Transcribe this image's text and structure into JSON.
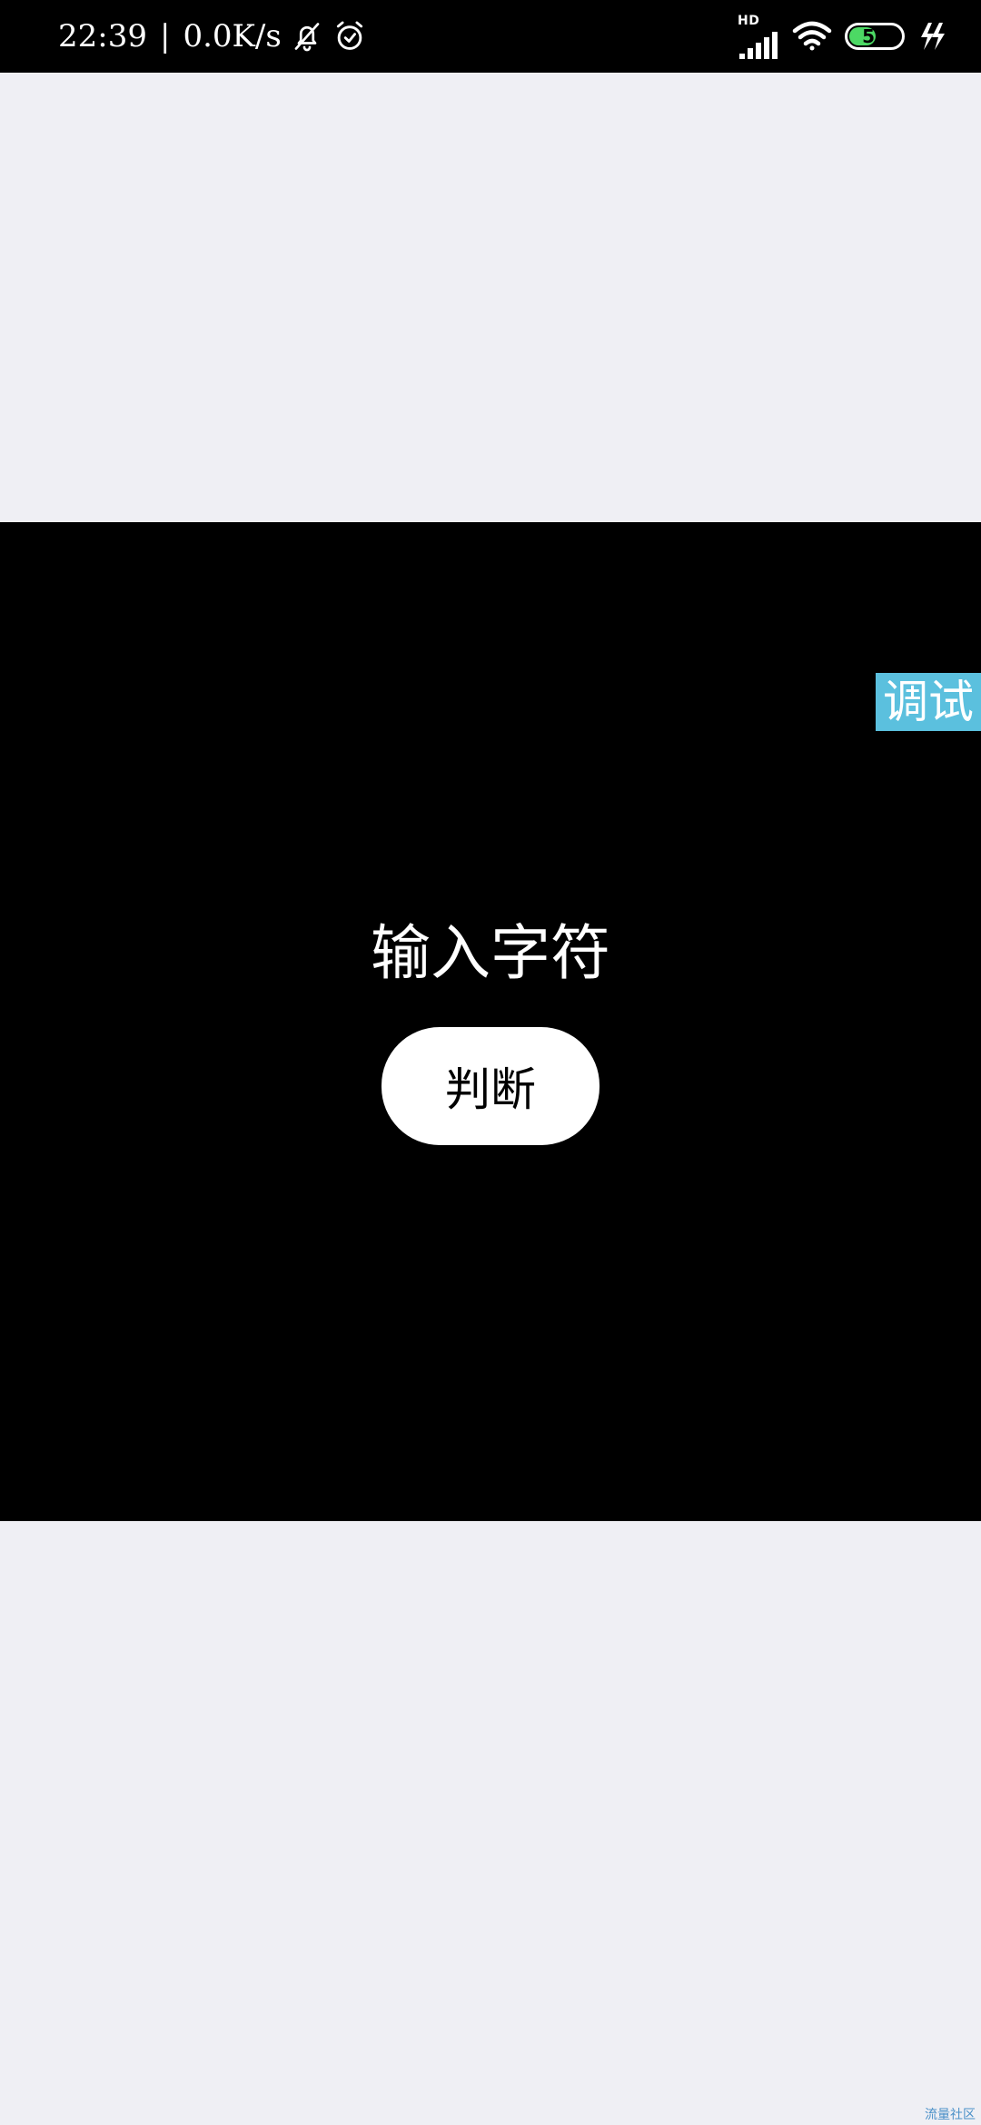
{
  "status_bar": {
    "time": "22:39",
    "separator": "|",
    "network_speed": "0.0K/s",
    "network_type": "HD",
    "battery_level": "51",
    "battery_fraction": 0.51,
    "icons": [
      "bell-off-icon",
      "alarm-icon",
      "cellular-signal-icon",
      "wifi-icon",
      "battery-icon",
      "charging-icon"
    ]
  },
  "main": {
    "prompt": "输入字符",
    "judge_button": "判断"
  },
  "debug_tab": {
    "label": "调试",
    "color": "#5bc0de"
  },
  "watermark": {
    "text": "流量社区"
  },
  "colors": {
    "page_background": "#efeff4",
    "panel_background": "#000000",
    "battery_fill": "#4cd964"
  }
}
